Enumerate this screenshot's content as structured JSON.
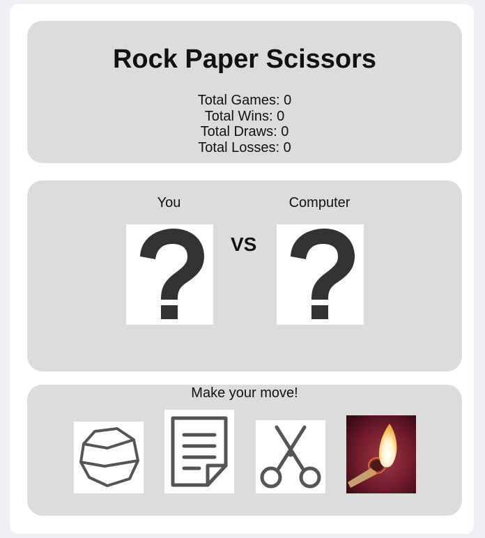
{
  "game": {
    "title": "Rock Paper Scissors"
  },
  "stats": [
    {
      "label": "Total Games: 0"
    },
    {
      "label": "Total Wins: 0"
    },
    {
      "label": "Total Draws: 0"
    },
    {
      "label": "Total Losses: 0"
    }
  ],
  "arena": {
    "player_label": "You",
    "computer_label": "Computer",
    "vs_label": "VS",
    "player_choice": "question-mark",
    "computer_choice": "question-mark"
  },
  "moves": {
    "prompt": "Make your move!",
    "options": [
      {
        "icon": "rock-icon"
      },
      {
        "icon": "paper-icon"
      },
      {
        "icon": "scissors-icon"
      },
      {
        "icon": "match-flame-icon"
      }
    ]
  },
  "colors": {
    "panel": "#dcdcdc",
    "card": "#ffffff",
    "page": "#f0eff5",
    "icon_stroke": "#555555",
    "question_mark": "#333333"
  }
}
